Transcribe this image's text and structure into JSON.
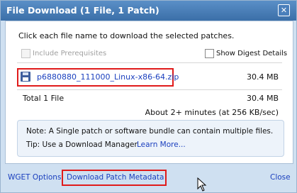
{
  "dialog": {
    "title": "File Download (1 File, 1 Patch)",
    "close_icon_glyph": "✕"
  },
  "main": {
    "instruction": "Click each file name to download the selected patches.",
    "include_prerequisites": {
      "label": "Include Prerequisites",
      "checked": false,
      "disabled": true
    },
    "show_digest_details": {
      "label": "Show Digest Details",
      "checked": false
    },
    "files": [
      {
        "name": "p6880880_111000_Linux-x86-64.zip",
        "size": "30.4 MB",
        "icon": "floppy-disk-icon"
      }
    ],
    "total_label": "Total 1 File",
    "total_size": "30.4 MB",
    "time_estimate": "About 2+ minutes (at 256 KB/sec)",
    "note": "Note: A Single patch or software bundle can contain multiple files.",
    "tip": "Tip: Use a Download Manager",
    "learn_more": "Learn More..."
  },
  "footer": {
    "wget_options": "WGET Options",
    "download_metadata": "Download Patch Metadata",
    "close": "Close"
  },
  "colors": {
    "highlight": "#e01b1b",
    "link": "#1a3fbe",
    "titlebar": "#3b6fa8",
    "dialog_bg": "#cfe0f1"
  }
}
